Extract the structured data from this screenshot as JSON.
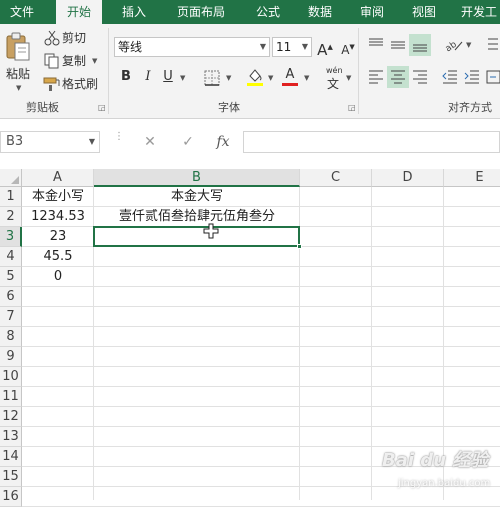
{
  "tabs": [
    "文件",
    "开始",
    "插入",
    "页面布局",
    "公式",
    "数据",
    "审阅",
    "视图",
    "开发工"
  ],
  "active_tab": "开始",
  "clipboard": {
    "paste_label": "粘贴",
    "cut_label": "剪切",
    "copy_label": "复制",
    "format_painter_label": "格式刷",
    "group_label": "剪贴板"
  },
  "font": {
    "font_name": "等线",
    "font_size": "11",
    "bold": "B",
    "italic": "I",
    "underline": "U",
    "grow": "A",
    "shrink": "A",
    "wen": "wén",
    "wen_char": "文",
    "font_color_letter": "A",
    "group_label": "字体",
    "font_color": "#e02020",
    "fill_color": "#ffff00"
  },
  "alignment": {
    "group_label": "对齐方式"
  },
  "formula_bar": {
    "name_box": "B3",
    "cancel": "✕",
    "enter": "✓",
    "fx": "fx",
    "content": ""
  },
  "columns": [
    "A",
    "B",
    "C",
    "D",
    "E"
  ],
  "rows": [
    "1",
    "2",
    "3",
    "4",
    "5",
    "6",
    "7",
    "8",
    "9",
    "10",
    "11",
    "12",
    "13",
    "14",
    "15",
    "16"
  ],
  "selected_cell": "B3",
  "cells": {
    "A1": "本金小写",
    "B1": "本金大写",
    "A2": "1234.53",
    "B2": "壹仟贰佰叁拾肆元伍角叁分",
    "A3": "23",
    "A4": "45.5",
    "A5": "0"
  },
  "watermark": {
    "brand": "Bai du 经验",
    "sub": "jingyan.baidu.com"
  },
  "accent_color": "#217346"
}
